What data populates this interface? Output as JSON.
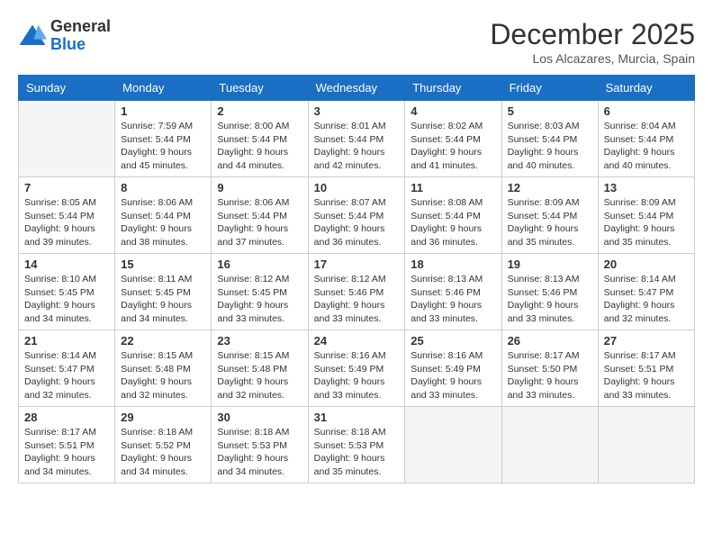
{
  "header": {
    "logo_general": "General",
    "logo_blue": "Blue",
    "month": "December 2025",
    "location": "Los Alcazares, Murcia, Spain"
  },
  "weekdays": [
    "Sunday",
    "Monday",
    "Tuesday",
    "Wednesday",
    "Thursday",
    "Friday",
    "Saturday"
  ],
  "weeks": [
    [
      {
        "day": "",
        "empty": true
      },
      {
        "day": "1",
        "sunrise": "Sunrise: 7:59 AM",
        "sunset": "Sunset: 5:44 PM",
        "daylight": "Daylight: 9 hours and 45 minutes."
      },
      {
        "day": "2",
        "sunrise": "Sunrise: 8:00 AM",
        "sunset": "Sunset: 5:44 PM",
        "daylight": "Daylight: 9 hours and 44 minutes."
      },
      {
        "day": "3",
        "sunrise": "Sunrise: 8:01 AM",
        "sunset": "Sunset: 5:44 PM",
        "daylight": "Daylight: 9 hours and 42 minutes."
      },
      {
        "day": "4",
        "sunrise": "Sunrise: 8:02 AM",
        "sunset": "Sunset: 5:44 PM",
        "daylight": "Daylight: 9 hours and 41 minutes."
      },
      {
        "day": "5",
        "sunrise": "Sunrise: 8:03 AM",
        "sunset": "Sunset: 5:44 PM",
        "daylight": "Daylight: 9 hours and 40 minutes."
      },
      {
        "day": "6",
        "sunrise": "Sunrise: 8:04 AM",
        "sunset": "Sunset: 5:44 PM",
        "daylight": "Daylight: 9 hours and 40 minutes."
      }
    ],
    [
      {
        "day": "7",
        "sunrise": "Sunrise: 8:05 AM",
        "sunset": "Sunset: 5:44 PM",
        "daylight": "Daylight: 9 hours and 39 minutes."
      },
      {
        "day": "8",
        "sunrise": "Sunrise: 8:06 AM",
        "sunset": "Sunset: 5:44 PM",
        "daylight": "Daylight: 9 hours and 38 minutes."
      },
      {
        "day": "9",
        "sunrise": "Sunrise: 8:06 AM",
        "sunset": "Sunset: 5:44 PM",
        "daylight": "Daylight: 9 hours and 37 minutes."
      },
      {
        "day": "10",
        "sunrise": "Sunrise: 8:07 AM",
        "sunset": "Sunset: 5:44 PM",
        "daylight": "Daylight: 9 hours and 36 minutes."
      },
      {
        "day": "11",
        "sunrise": "Sunrise: 8:08 AM",
        "sunset": "Sunset: 5:44 PM",
        "daylight": "Daylight: 9 hours and 36 minutes."
      },
      {
        "day": "12",
        "sunrise": "Sunrise: 8:09 AM",
        "sunset": "Sunset: 5:44 PM",
        "daylight": "Daylight: 9 hours and 35 minutes."
      },
      {
        "day": "13",
        "sunrise": "Sunrise: 8:09 AM",
        "sunset": "Sunset: 5:44 PM",
        "daylight": "Daylight: 9 hours and 35 minutes."
      }
    ],
    [
      {
        "day": "14",
        "sunrise": "Sunrise: 8:10 AM",
        "sunset": "Sunset: 5:45 PM",
        "daylight": "Daylight: 9 hours and 34 minutes."
      },
      {
        "day": "15",
        "sunrise": "Sunrise: 8:11 AM",
        "sunset": "Sunset: 5:45 PM",
        "daylight": "Daylight: 9 hours and 34 minutes."
      },
      {
        "day": "16",
        "sunrise": "Sunrise: 8:12 AM",
        "sunset": "Sunset: 5:45 PM",
        "daylight": "Daylight: 9 hours and 33 minutes."
      },
      {
        "day": "17",
        "sunrise": "Sunrise: 8:12 AM",
        "sunset": "Sunset: 5:46 PM",
        "daylight": "Daylight: 9 hours and 33 minutes."
      },
      {
        "day": "18",
        "sunrise": "Sunrise: 8:13 AM",
        "sunset": "Sunset: 5:46 PM",
        "daylight": "Daylight: 9 hours and 33 minutes."
      },
      {
        "day": "19",
        "sunrise": "Sunrise: 8:13 AM",
        "sunset": "Sunset: 5:46 PM",
        "daylight": "Daylight: 9 hours and 33 minutes."
      },
      {
        "day": "20",
        "sunrise": "Sunrise: 8:14 AM",
        "sunset": "Sunset: 5:47 PM",
        "daylight": "Daylight: 9 hours and 32 minutes."
      }
    ],
    [
      {
        "day": "21",
        "sunrise": "Sunrise: 8:14 AM",
        "sunset": "Sunset: 5:47 PM",
        "daylight": "Daylight: 9 hours and 32 minutes."
      },
      {
        "day": "22",
        "sunrise": "Sunrise: 8:15 AM",
        "sunset": "Sunset: 5:48 PM",
        "daylight": "Daylight: 9 hours and 32 minutes."
      },
      {
        "day": "23",
        "sunrise": "Sunrise: 8:15 AM",
        "sunset": "Sunset: 5:48 PM",
        "daylight": "Daylight: 9 hours and 32 minutes."
      },
      {
        "day": "24",
        "sunrise": "Sunrise: 8:16 AM",
        "sunset": "Sunset: 5:49 PM",
        "daylight": "Daylight: 9 hours and 33 minutes."
      },
      {
        "day": "25",
        "sunrise": "Sunrise: 8:16 AM",
        "sunset": "Sunset: 5:49 PM",
        "daylight": "Daylight: 9 hours and 33 minutes."
      },
      {
        "day": "26",
        "sunrise": "Sunrise: 8:17 AM",
        "sunset": "Sunset: 5:50 PM",
        "daylight": "Daylight: 9 hours and 33 minutes."
      },
      {
        "day": "27",
        "sunrise": "Sunrise: 8:17 AM",
        "sunset": "Sunset: 5:51 PM",
        "daylight": "Daylight: 9 hours and 33 minutes."
      }
    ],
    [
      {
        "day": "28",
        "sunrise": "Sunrise: 8:17 AM",
        "sunset": "Sunset: 5:51 PM",
        "daylight": "Daylight: 9 hours and 34 minutes."
      },
      {
        "day": "29",
        "sunrise": "Sunrise: 8:18 AM",
        "sunset": "Sunset: 5:52 PM",
        "daylight": "Daylight: 9 hours and 34 minutes."
      },
      {
        "day": "30",
        "sunrise": "Sunrise: 8:18 AM",
        "sunset": "Sunset: 5:53 PM",
        "daylight": "Daylight: 9 hours and 34 minutes."
      },
      {
        "day": "31",
        "sunrise": "Sunrise: 8:18 AM",
        "sunset": "Sunset: 5:53 PM",
        "daylight": "Daylight: 9 hours and 35 minutes."
      },
      {
        "day": "",
        "empty": true
      },
      {
        "day": "",
        "empty": true
      },
      {
        "day": "",
        "empty": true
      }
    ]
  ]
}
